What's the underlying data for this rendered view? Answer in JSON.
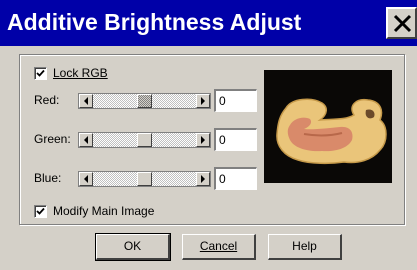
{
  "window": {
    "title": "Additive Brightness Adjust"
  },
  "lock_rgb": {
    "label": "Lock RGB",
    "checked": true
  },
  "sliders": [
    {
      "label": "Red:",
      "value": "0",
      "position": 0.5,
      "focused": true
    },
    {
      "label": "Green:",
      "value": "0",
      "position": 0.5,
      "focused": false
    },
    {
      "label": "Blue:",
      "value": "0",
      "position": 0.5,
      "focused": false
    }
  ],
  "modify_main": {
    "label": "Modify Main Image",
    "checked": true
  },
  "buttons": {
    "ok": "OK",
    "cancel": "Cancel",
    "help": "Help"
  },
  "colors": {
    "titlebar": "#0000a8",
    "face": "#d4d0c8",
    "preview_bg": "#000000"
  }
}
